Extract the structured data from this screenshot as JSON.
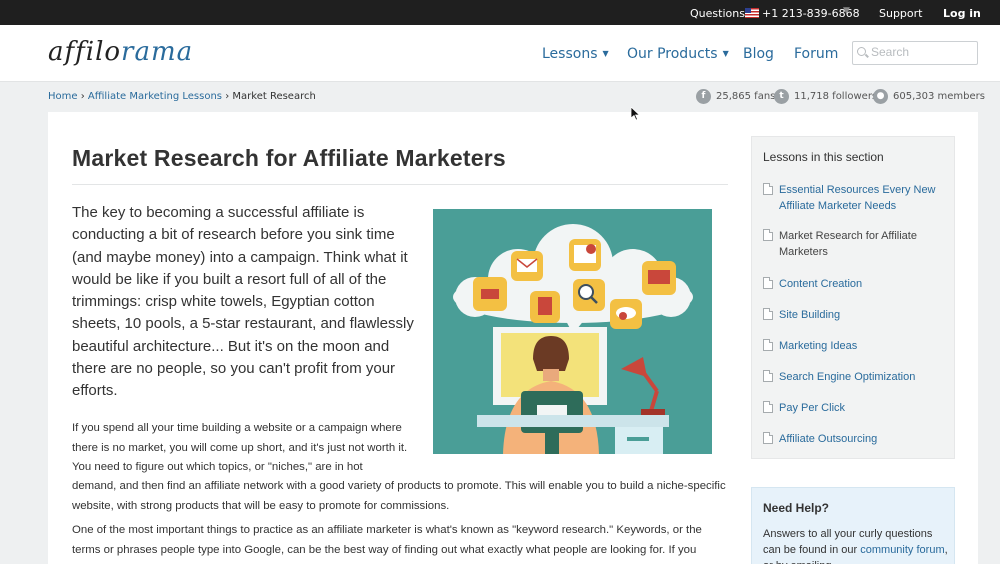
{
  "topbar": {
    "questions": "Questions?",
    "phone": "+1 213-839-6868",
    "support": "Support",
    "login": "Log in"
  },
  "header": {
    "logo_a": "a",
    "logo_ffilo": "ffilo",
    "logo_rama": "rama",
    "nav": {
      "lessons": "Lessons",
      "products": "Our Products",
      "blog": "Blog",
      "forum": "Forum"
    },
    "search_placeholder": "Search"
  },
  "breadcrumb": {
    "home": "Home",
    "sep": "›",
    "section": "Affiliate Marketing Lessons",
    "current": "Market Research"
  },
  "social": {
    "fans": "25,865 fans",
    "followers": "11,718 followers",
    "members": "605,303 members"
  },
  "article": {
    "title": "Market Research for Affiliate Marketers",
    "lead": "The key to becoming a successful affiliate is conducting a bit of research before you sink time (and maybe money) into a campaign. Think what it would be like if you built a resort full of all of the trimmings: crisp white towels, Egyptian cotton sheets, 10 pools, a 5-star restaurant, and flawlessly beautiful architecture... But it's on the moon and there are no people, so you can't profit from your efforts.",
    "p1a": "If you spend all your time building a website or a campaign where there is no market, you will come up short, and it's just not worth it. You need to figure out which topics, or \"niches,\" are in hot",
    "p1b": "demand, and then find an affiliate network with a good variety of products to promote. This will enable you to build a niche-specific website, with strong products that will be easy to promote for commissions.",
    "p2": "One of the most important things to practice as an affiliate marketer is what's known as \"keyword research.\" Keywords, or the terms or phrases people type into Google, can be the best way of finding out what exactly what people are looking for. If you"
  },
  "sidebar": {
    "lessons_heading": "Lessons in this section",
    "lessons": [
      "Essential Resources Every New Affiliate Marketer Needs",
      "Market Research for Affiliate Marketers",
      "Content Creation",
      "Site Building",
      "Marketing Ideas",
      "Search Engine Optimization",
      "Pay Per Click",
      "Affiliate Outsourcing"
    ],
    "help_heading": "Need Help?",
    "help_text": "Answers to all your curly questions can be found in our",
    "help_link": "community forum",
    "help_tail": ", or by emailing"
  }
}
